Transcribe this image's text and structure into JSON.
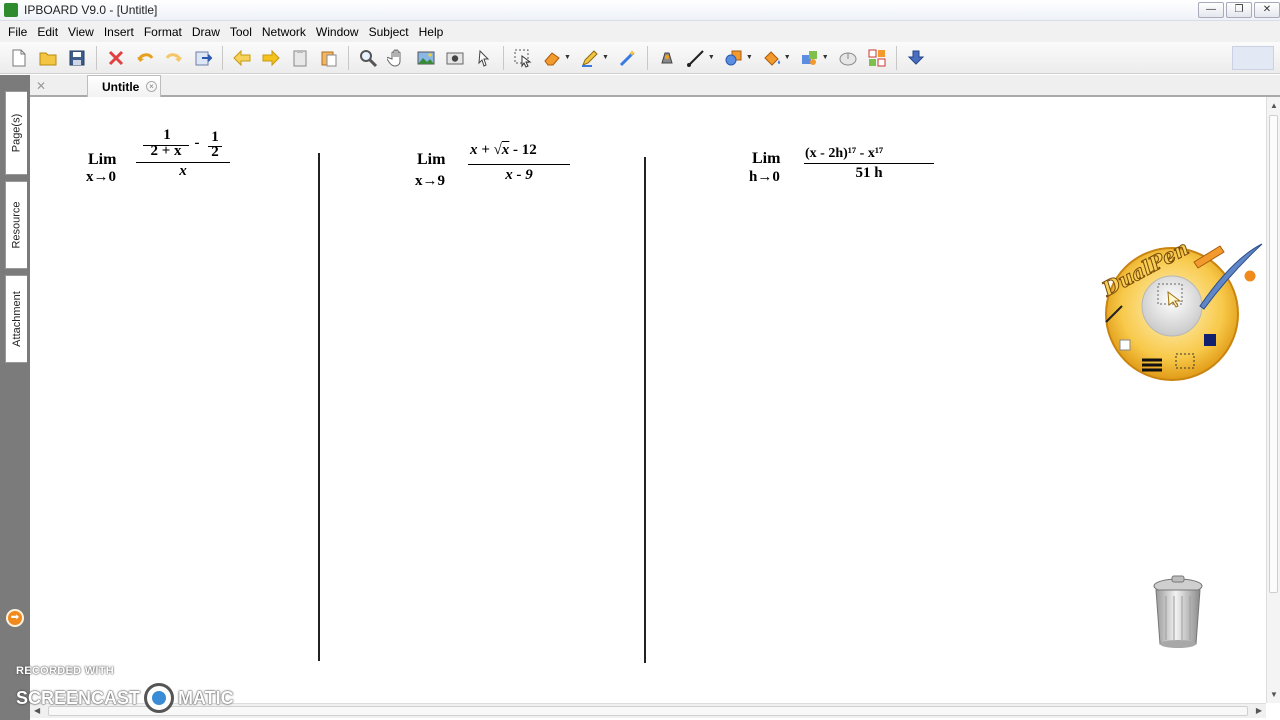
{
  "window": {
    "title": "IPBOARD V9.0 - [Untitle]",
    "controls": {
      "minimize": "—",
      "restore": "❐",
      "close": "✕"
    }
  },
  "menu": {
    "items": [
      "File",
      "Edit",
      "View",
      "Insert",
      "Format",
      "Draw",
      "Tool",
      "Network",
      "Window",
      "Subject",
      "Help"
    ]
  },
  "toolbar": {
    "icons": [
      "new-page-icon",
      "open-folder-icon",
      "save-icon",
      "delete-icon",
      "undo-icon",
      "redo-icon",
      "export-icon",
      "previous-page-icon",
      "next-page-icon",
      "clipboard-icon",
      "paste-icon",
      "zoom-icon",
      "hand-icon",
      "picture-icon",
      "camera-icon",
      "pointer-icon",
      "select-icon",
      "eraser-icon",
      "pen-icon",
      "magic-pen-icon",
      "stamp-pen-icon",
      "line-icon",
      "shape-icon",
      "fill-icon",
      "tools-icon",
      "mouse-icon",
      "layout-icon",
      "download-icon"
    ]
  },
  "tabs": {
    "document": "Untitle",
    "close_symbol": "×",
    "strip_close": "✕"
  },
  "side_panel": {
    "tabs": [
      "Page(s)",
      "Resource",
      "Attachment"
    ],
    "expand_arrow": "➡"
  },
  "problems": [
    {
      "lim": "Lim",
      "approach": "x→0",
      "numerator": "1/(2+x) − 1/2",
      "denominator": "x"
    },
    {
      "lim": "Lim",
      "approach": "x→9",
      "numerator": "x + √x − 12",
      "denominator": "x − 9"
    },
    {
      "lim": "Lim",
      "approach": "h→0",
      "numerator": "(x − 2h)¹⁷ − x¹⁷",
      "denominator": "51 h"
    }
  ],
  "problem1": {
    "lim": "Lim",
    "approach": "x→0",
    "inner_num1": "1",
    "inner_den1": "2 + x",
    "minus": "-",
    "inner_num2": "1",
    "inner_den2": "2",
    "denominator": "x"
  },
  "problem2": {
    "lim": "Lim",
    "approach": "x→9",
    "num_prefix": "x + ",
    "radical": "√",
    "radicand": "x",
    "num_suffix": " - 12",
    "denominator": "x - 9"
  },
  "problem3": {
    "lim": "Lim",
    "approach": "h→0",
    "numerator": "(x - 2h)¹⁷ - x¹⁷",
    "denominator": "51 h"
  },
  "dualpen": {
    "label": "DualPen"
  },
  "watermark": {
    "line1": "RECORDED WITH",
    "brand_left": "SCREENCAST",
    "brand_right": "MATIC"
  },
  "colors": {
    "menu_bg": "#f1f1f1",
    "side_panel": "#7b7b7b",
    "accent_orange": "#f08a1c"
  }
}
